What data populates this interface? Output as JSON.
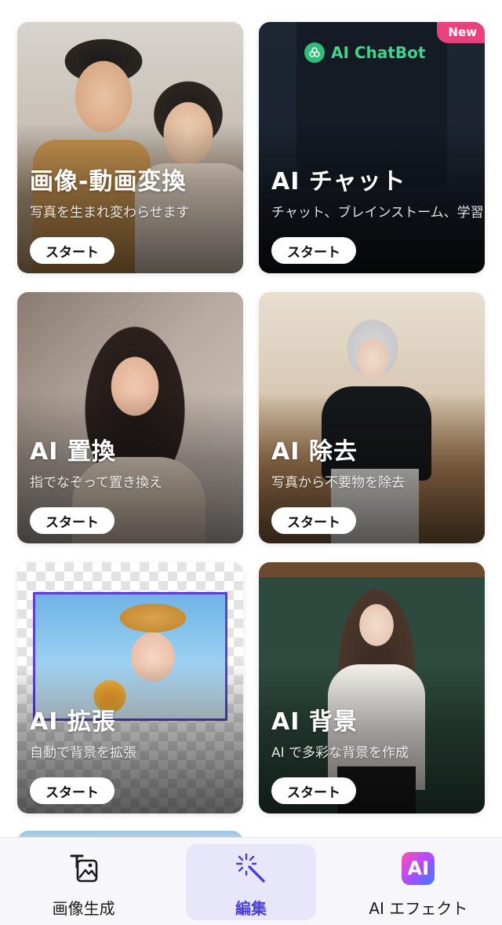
{
  "cards": [
    {
      "title": "画像-動画変換",
      "subtitle": "写真を生まれ変わらせます",
      "button": "スタート"
    },
    {
      "title": "AI チャット",
      "subtitle": "チャット、ブレインストーム、学習",
      "button": "スタート",
      "badge": "New",
      "brand": "AI ChatBot"
    },
    {
      "title": "AI 置換",
      "subtitle": "指でなぞって置き換え",
      "button": "スタート"
    },
    {
      "title": "AI 除去",
      "subtitle": "写真から不要物を除去",
      "button": "スタート"
    },
    {
      "title": "AI 拡張",
      "subtitle": "自動で背景を拡張",
      "button": "スタート"
    },
    {
      "title": "AI 背景",
      "subtitle": "AI で多彩な背景を作成",
      "button": "スタート"
    }
  ],
  "bottom_nav": {
    "items": [
      {
        "label": "画像生成",
        "icon": "text-to-image-icon"
      },
      {
        "label": "編集",
        "icon": "magic-wand-icon",
        "active": true
      },
      {
        "label": "AI エフェクト",
        "icon": "ai-effect-icon"
      }
    ]
  },
  "colors": {
    "accent": "#4a3fd3",
    "active_pill": "#e8e6fb",
    "new_badge": "#e8417d",
    "chatbot_green": "#3fd38c"
  }
}
